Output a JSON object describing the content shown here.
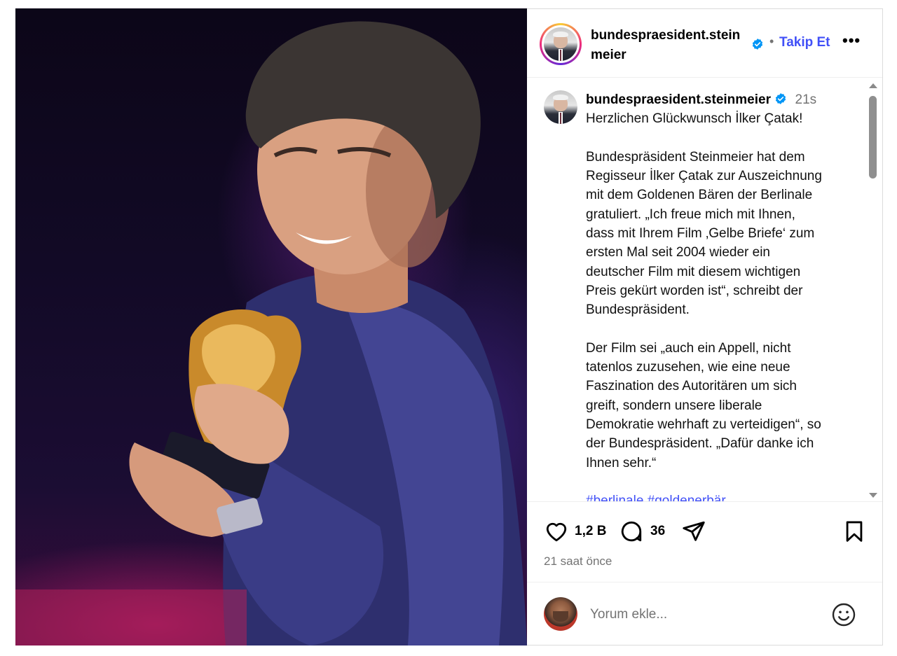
{
  "post": {
    "image_alt": "",
    "header": {
      "username": "bundespraesident.steinmeier",
      "separator": "•",
      "follow_label": "Takip Et",
      "more_label": "•••"
    },
    "caption": {
      "username": "bundespraesident.steinmeier",
      "time": "21s",
      "lines": [
        "Herzlichen Glückwunsch İlker Çatak!",
        "",
        "Bundespräsident Steinmeier hat dem",
        "Regisseur İlker Çatak zur Auszeichnung",
        "mit dem Goldenen Bären der Berlinale",
        "gratuliert. „Ich freue mich mit Ihnen,",
        "dass mit Ihrem Film ‚Gelbe Briefe‘ zum",
        "ersten Mal seit 2004 wieder ein",
        "deutscher Film mit diesem wichtigen",
        "Preis gekürt worden ist“, schreibt der",
        "Bundespräsident.",
        "",
        "Der Film sei „auch ein Appell, nicht",
        "tatenlos zuzusehen, wie eine neue",
        "Faszination des Autoritären um sich",
        "greift, sondern unsere liberale",
        "Demokratie wehrhaft zu verteidigen“, so",
        "der Bundespräsident. „Dafür danke ich",
        "Ihnen sehr.“",
        ""
      ],
      "hashtags": "#berlinale #goldenerbär"
    },
    "actions": {
      "like_count": "1,2 B",
      "comment_count": "36",
      "time_ago": "21 saat önce"
    },
    "comment_box": {
      "placeholder": "Yorum ekle..."
    }
  },
  "icons": {
    "verified": "verified-badge-icon",
    "like": "heart-icon",
    "comment": "comment-bubble-icon",
    "share": "send-icon",
    "save": "bookmark-icon",
    "emoji": "smiley-icon",
    "more": "more-options-icon"
  },
  "colors": {
    "link_blue": "#4150f7",
    "verified_blue": "#0095f6",
    "muted_text": "#737373",
    "border": "#dbdbdb"
  }
}
